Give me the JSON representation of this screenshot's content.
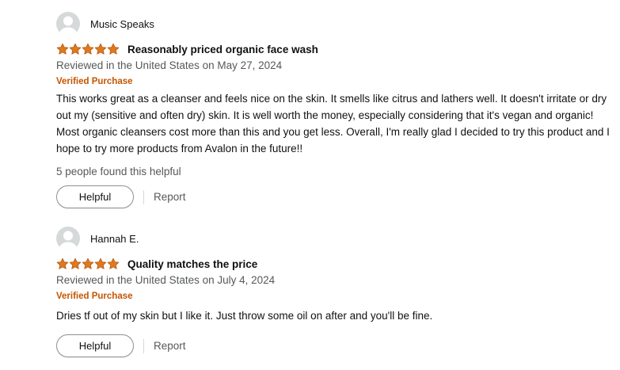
{
  "reviews": [
    {
      "reviewer": "Music Speaks",
      "rating": 5,
      "title": "Reasonably priced organic face wash",
      "meta": "Reviewed in the United States on May 27, 2024",
      "verified": "Verified Purchase",
      "body": "This works great as a cleanser and feels nice on the skin. It smells like citrus and lathers well. It doesn't irritate or dry out my (sensitive and often dry) skin. It is well worth the money, especially considering that it's vegan and organic! Most organic cleansers cost more than this and you get less. Overall, I'm really glad I decided to try this product and I hope to try more products from Avalon in the future!!",
      "helpful_count": "5 people found this helpful",
      "helpful_label": "Helpful",
      "report_label": "Report"
    },
    {
      "reviewer": "Hannah E.",
      "rating": 5,
      "title": "Quality matches the price",
      "meta": "Reviewed in the United States on July 4, 2024",
      "verified": "Verified Purchase",
      "body": "Dries tf out of my skin but I like it. Just throw some oil on after and you'll be fine.",
      "helpful_label": "Helpful",
      "report_label": "Report"
    }
  ],
  "colors": {
    "star": "#de7921",
    "verified": "#c45500",
    "meta": "#565959"
  }
}
